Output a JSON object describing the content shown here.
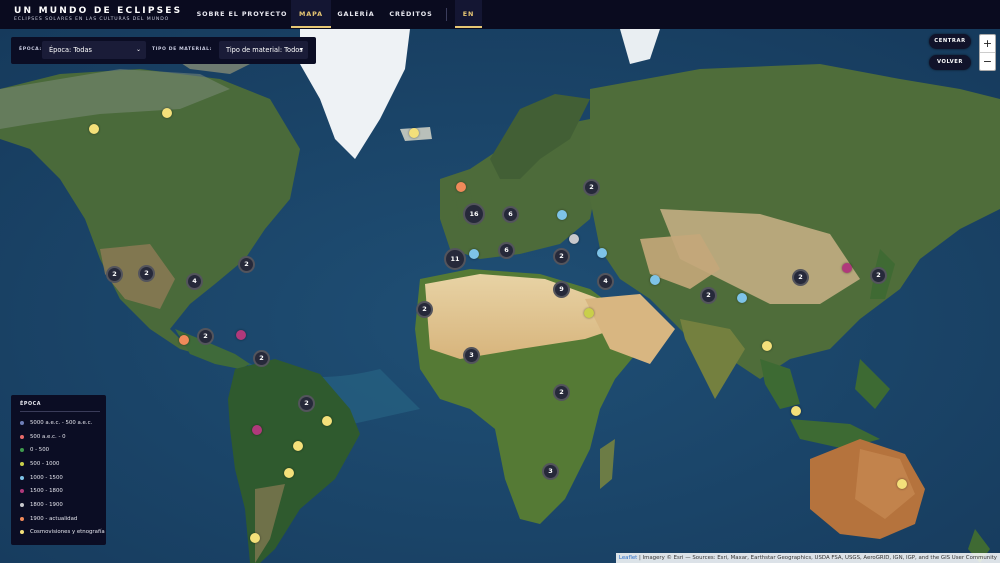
{
  "brand": {
    "title": "UN MUNDO DE ECLIPSES",
    "subtitle": "ECLIPSES SOLARES EN LAS CULTURAS DEL MUNDO"
  },
  "nav": [
    {
      "label": "SOBRE EL PROYECTO",
      "active": false
    },
    {
      "label": "MAPA",
      "active": true
    },
    {
      "label": "GALERÍA",
      "active": false
    },
    {
      "label": "CRÉDITOS",
      "active": false
    },
    {
      "label": "EN",
      "active": true
    }
  ],
  "filters": {
    "epoch_label": "ÉPOCA:",
    "epoch_value": "Época: Todas",
    "material_label": "TIPO DE MATERIAL:",
    "material_value": "Tipo de material: Todos"
  },
  "controls": {
    "center": "CENTRAR",
    "back": "VOLVER",
    "zoom_in": "+",
    "zoom_out": "−"
  },
  "legend": {
    "title": "ÉPOCA",
    "items": [
      {
        "label": "5000 a.e.c. - 500 a.e.c.",
        "color": "#6f7fb8"
      },
      {
        "label": "500 a.e.c. - 0",
        "color": "#e86b6b"
      },
      {
        "label": "0 - 500",
        "color": "#3f9a4e"
      },
      {
        "label": "500 - 1000",
        "color": "#c9cf4a"
      },
      {
        "label": "1000 - 1500",
        "color": "#7ec3e8"
      },
      {
        "label": "1500 - 1800",
        "color": "#b0397b"
      },
      {
        "label": "1800 - 1900",
        "color": "#c8c8cc"
      },
      {
        "label": "1900 - actualidad",
        "color": "#f08a5a"
      },
      {
        "label": "Cosmovisiones y etnografía",
        "color": "#f4e07a"
      }
    ]
  },
  "clusters": [
    "2",
    "16",
    "6",
    "2",
    "11",
    "6",
    "2",
    "2",
    "4",
    "2",
    "2",
    "2",
    "4",
    "2",
    "9",
    "2",
    "2",
    "2",
    "2",
    "3",
    "2",
    "3",
    "3"
  ],
  "attribution": {
    "leaflet": "Leaflet",
    "text": " | Imagery © Esri — Sources: Esri, Maxar, Earthstar Geographics, USDA FSA, USGS, AeroGRID, IGN, IGP, and the GIS User Community"
  }
}
